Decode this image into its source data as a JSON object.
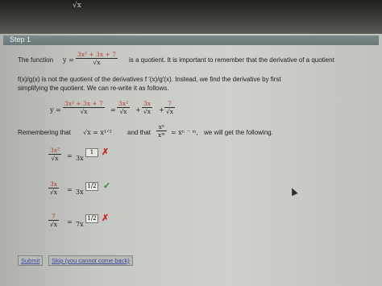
{
  "top_fragment": "√x",
  "step": {
    "label": "Step 1"
  },
  "intro": {
    "line1_prefix": "The function",
    "y_eq": "y =",
    "func_num": "3x² + 3x + 7",
    "func_den": "√x",
    "line1_suffix": "is a quotient. It is important to remember that the derivative of a quotient",
    "line2": "f(x)/g(x) is not the quotient of the derivatives f ′(x)/g′(x). Instead, we find the derivative by first",
    "line3": "simplifying the quotient. We can re-write it as follows."
  },
  "rewrite": {
    "y_eq": "y =",
    "lhs_num": "3x² + 3x + 7",
    "lhs_den": "√x",
    "eq": "=",
    "t1_num": "3x²",
    "t2_num": "3x",
    "t3_num": "7",
    "den": "√x",
    "plus": "+"
  },
  "remember": {
    "prefix": "Remembering that",
    "rule1": "√x = x¹ᐟ²",
    "and_that": "and that",
    "rule2_num": "xⁿ",
    "rule2_den": "xᵐ",
    "rule2_rhs": "= xⁿ ⁻ ᵐ,",
    "suffix": "we will get the following."
  },
  "answers": [
    {
      "num": "3x²",
      "den": "√x",
      "eq": "=",
      "base": "3x",
      "exponent": "1",
      "status": "✗"
    },
    {
      "num": "3x",
      "den": "√x",
      "eq": "=",
      "base": "3x",
      "exponent": "1/2",
      "status": "✓"
    },
    {
      "num": "7",
      "den": "√x",
      "eq": "=",
      "base": "7x",
      "exponent": "1/2",
      "status": "✗"
    }
  ],
  "buttons": {
    "submit": "Submit",
    "skip": "Skip (you cannot come back)"
  }
}
